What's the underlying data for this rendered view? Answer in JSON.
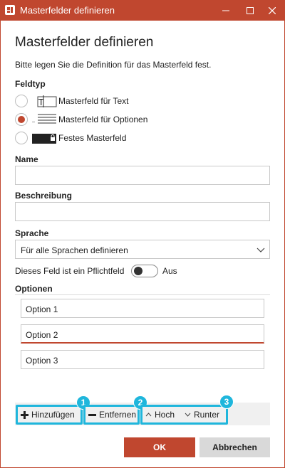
{
  "window": {
    "title": "Masterfelder definieren",
    "accent_color": "#c0472f",
    "highlight_color": "#1fb6dc"
  },
  "dialog": {
    "heading": "Masterfelder definieren",
    "description": "Bitte legen Sie die Definition für das Masterfeld fest."
  },
  "feldtyp": {
    "label": "Feldtyp",
    "options": [
      {
        "label": "Masterfeld für Text",
        "icon": "text-field-icon",
        "checked": false
      },
      {
        "label": "Masterfeld für Optionen",
        "icon": "list-options-icon",
        "checked": true
      },
      {
        "label": "Festes Masterfeld",
        "icon": "locked-field-icon",
        "checked": false
      }
    ]
  },
  "name": {
    "label": "Name",
    "value": ""
  },
  "beschreibung": {
    "label": "Beschreibung",
    "value": ""
  },
  "sprache": {
    "label": "Sprache",
    "selected": "Für alle Sprachen definieren"
  },
  "pflichtfeld": {
    "label": "Dieses Feld ist ein Pflichtfeld",
    "state": "Aus"
  },
  "optionen": {
    "label": "Optionen",
    "items": [
      "Option 1",
      "Option 2",
      "Option 3"
    ]
  },
  "toolbar": {
    "add_label": "Hinzufügen",
    "remove_label": "Entfernen",
    "up_label": "Hoch",
    "down_label": "Runter",
    "badges": [
      "1",
      "2",
      "3"
    ]
  },
  "footer": {
    "ok_label": "OK",
    "cancel_label": "Abbrechen"
  }
}
